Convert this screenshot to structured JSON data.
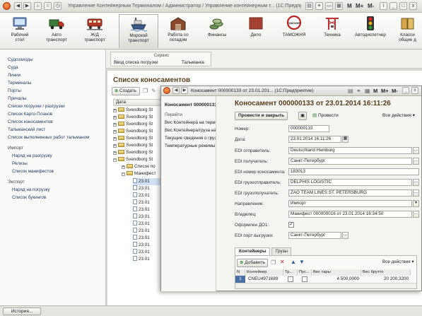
{
  "titlebar": {
    "title": "Управление Контейнерным Терминалом / Администратор / Управление контейнерным т... (1С:Предприятие)",
    "m_buttons": [
      "M",
      "M+",
      "M-"
    ],
    "window_buttons": [
      "i",
      "_",
      "□",
      "x"
    ]
  },
  "sections": [
    {
      "label1": "Рабочий",
      "label2": "стол",
      "icon": "desktop-icon"
    },
    {
      "label1": "Авто",
      "label2": "транспорт",
      "icon": "truck-icon"
    },
    {
      "label1": "Ж/Д",
      "label2": "транспорт",
      "icon": "train-icon"
    },
    {
      "label1": "Морской",
      "label2": "транспорт",
      "icon": "ship-icon"
    },
    {
      "label1": "Работа со",
      "label2": "складом",
      "icon": "warehouse-icon"
    },
    {
      "label1": "Финансы",
      "label2": "",
      "icon": "coins-icon"
    },
    {
      "label1": "Депо",
      "label2": "",
      "icon": "container-icon"
    },
    {
      "label1": "ТАМОЖНЯ",
      "label2": "",
      "icon": "customs-sign-icon",
      "sign": "ТАМОЖНЯ"
    },
    {
      "label1": "Техника",
      "label2": "",
      "icon": "crane-icon"
    },
    {
      "label1": "Автодиспетчер",
      "label2": "",
      "icon": "traffic-light-icon"
    },
    {
      "label1": "Класси",
      "label2": "общие д",
      "icon": "book-icon"
    }
  ],
  "sidebar": {
    "links": [
      "Судозаходы",
      "Суда",
      "Линии",
      "Терминалы",
      "Порты",
      "Причалы",
      "Списки погрузки / разгрузки",
      "Список Карго-Планов",
      "Список коносаментов",
      "Тальманский лист",
      "Список выполненных работ тальманом"
    ],
    "import_header": "Импорт",
    "import_links": [
      "Наряд на разгрузку",
      "Релизы",
      "Список манифестов"
    ],
    "export_header": "Экспорт",
    "export_links": [
      "Наряд на погрузку",
      "Список букингов"
    ]
  },
  "service": {
    "title": "Сервис",
    "items": [
      "Ввод списка погрузки",
      "Тальманка"
    ]
  },
  "list": {
    "title": "Список коносаментов",
    "create_label": "Создать",
    "column": "Дата",
    "group_rows": [
      "Svendborg St",
      "Svendborg St",
      "Svendborg St",
      "Svendborg St",
      "Svendborg St",
      "Svendborg St",
      "Svendborg St",
      "Svendborg St"
    ],
    "sub_rows": [
      "Список по",
      "Манифест"
    ],
    "doc_rows": [
      "23.01",
      "23.01",
      "23.01",
      "23.01",
      "23.01",
      "23.01",
      "23.01",
      "23.01",
      "23.01",
      "23.01",
      "23.01",
      "23.01"
    ]
  },
  "status": {
    "history_label": "История..."
  },
  "doc_window": {
    "title": "Коносамент 000000133 от 23.01.201... (1С:Предприятие)",
    "m_buttons": [
      "M",
      "M+",
      "M-"
    ],
    "nav": {
      "header": "Коносамент 000000133...",
      "section": "Перейти",
      "items": [
        "Вес Контейнера на терми...",
        "Вес Контейнера/груза на ...",
        "Текущие сведения о груз...",
        "Температурные режимы ..."
      ]
    },
    "form": {
      "title": "Коносамент 000000133 от 23.01.2014 16:11:26",
      "post_close_label": "Провести и закрыть",
      "post_label": "Провести",
      "all_actions_label": "Все действия",
      "fields": [
        {
          "label": "Номер:",
          "value": "000000133"
        },
        {
          "label": "Дата:",
          "value": "23.01.2014 16:11:26"
        },
        {
          "label": "EDI отправитель:",
          "value": "Deutschland Hamburg"
        },
        {
          "label": "EDI получатель:",
          "value": "Санкт-Петербург"
        },
        {
          "label": "EDI номер коносамента:",
          "value": "183013"
        },
        {
          "label": "EDI грузоотправитель:",
          "value": "DELPHIS LOGISTIC"
        },
        {
          "label": "EDI грузополучатель:",
          "value": "ZAO TEAM LINES ST. PETERSBURG"
        },
        {
          "label": "Направление:",
          "value": "Импорт"
        },
        {
          "label": "Владелец:",
          "value": "Манифест 000000016 от 23.01.2014 16:34:50"
        },
        {
          "label": "Оформлен ДО1:",
          "value": "✓"
        },
        {
          "label": "EDI порт выгрузки:",
          "value": "Санкт-Петербург"
        }
      ],
      "tabs": [
        "Контейнеры",
        "Грузы"
      ],
      "add_label": "Добавить",
      "table_actions_label": "Все действия",
      "columns": [
        "N",
        "Контейнер",
        "Тр...",
        "Пус...",
        "Вес тары",
        "Вес брутто"
      ],
      "rows": [
        {
          "n": "1",
          "container": "CNEU4971689",
          "tare": "4 500,0000",
          "gross": "20 200,3200"
        }
      ]
    }
  }
}
